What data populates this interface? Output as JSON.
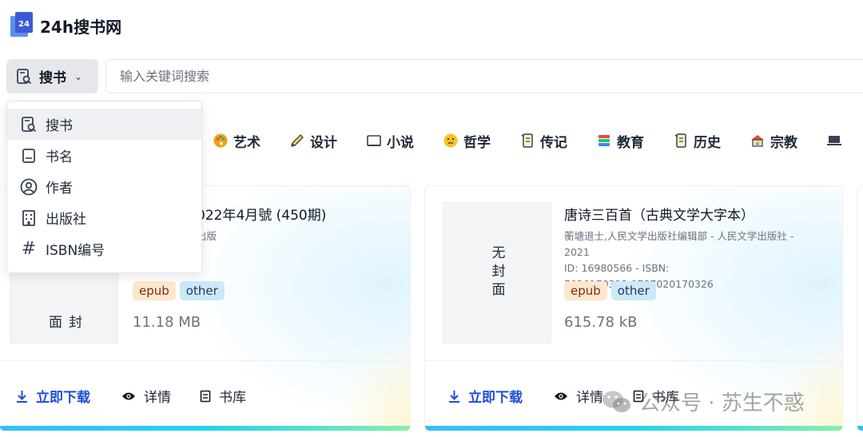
{
  "header": {
    "brand": "24h搜书网",
    "logo_text": "24"
  },
  "search": {
    "type_label": "搜书",
    "placeholder": "输入关键词搜索",
    "value": ""
  },
  "dropdown": {
    "options": [
      {
        "label": "搜书",
        "icon": "search-book-icon",
        "selected": true
      },
      {
        "label": "书名",
        "icon": "book-icon",
        "selected": false
      },
      {
        "label": "作者",
        "icon": "user-icon",
        "selected": false
      },
      {
        "label": "出版社",
        "icon": "building-icon",
        "selected": false
      },
      {
        "label": "ISBN编号",
        "icon": "hash-icon",
        "selected": false
      }
    ]
  },
  "categories": [
    {
      "label": "艺术",
      "icon": "palette-icon"
    },
    {
      "label": "设计",
      "icon": "pencil-icon"
    },
    {
      "label": "小说",
      "icon": "open-book-icon"
    },
    {
      "label": "哲学",
      "icon": "thinking-face-icon"
    },
    {
      "label": "传记",
      "icon": "scroll-icon"
    },
    {
      "label": "教育",
      "icon": "books-stack-icon"
    },
    {
      "label": "历史",
      "icon": "scroll-icon"
    },
    {
      "label": "宗教",
      "icon": "temple-icon"
    }
  ],
  "books": [
    {
      "cover_text": "封面",
      "title": "022年4月號 (450期)",
      "meta": "出版",
      "tags": [
        "epub",
        "other"
      ],
      "size": "11.18 MB"
    },
    {
      "cover_text": "无封面",
      "title": "唐诗三百首（古典文学大字本）",
      "meta": "蘅塘退士,人民文学出版社编辑部 - 人民文学出版社 - 2021",
      "id_line": "ID: 16980566 - ISBN: 7020170323,9787020170326",
      "tags": [
        "epub",
        "other"
      ],
      "size": "615.78 kB"
    }
  ],
  "actions": {
    "download": "立即下载",
    "details": "详情",
    "library": "书库"
  },
  "watermark": "公众号 · 苏生不惑",
  "colors": {
    "primary": "#1d4ed8",
    "epub_tag_bg": "#fde7cf",
    "other_tag_bg": "#cde8f8",
    "accent_bar": "#38bdf8"
  }
}
